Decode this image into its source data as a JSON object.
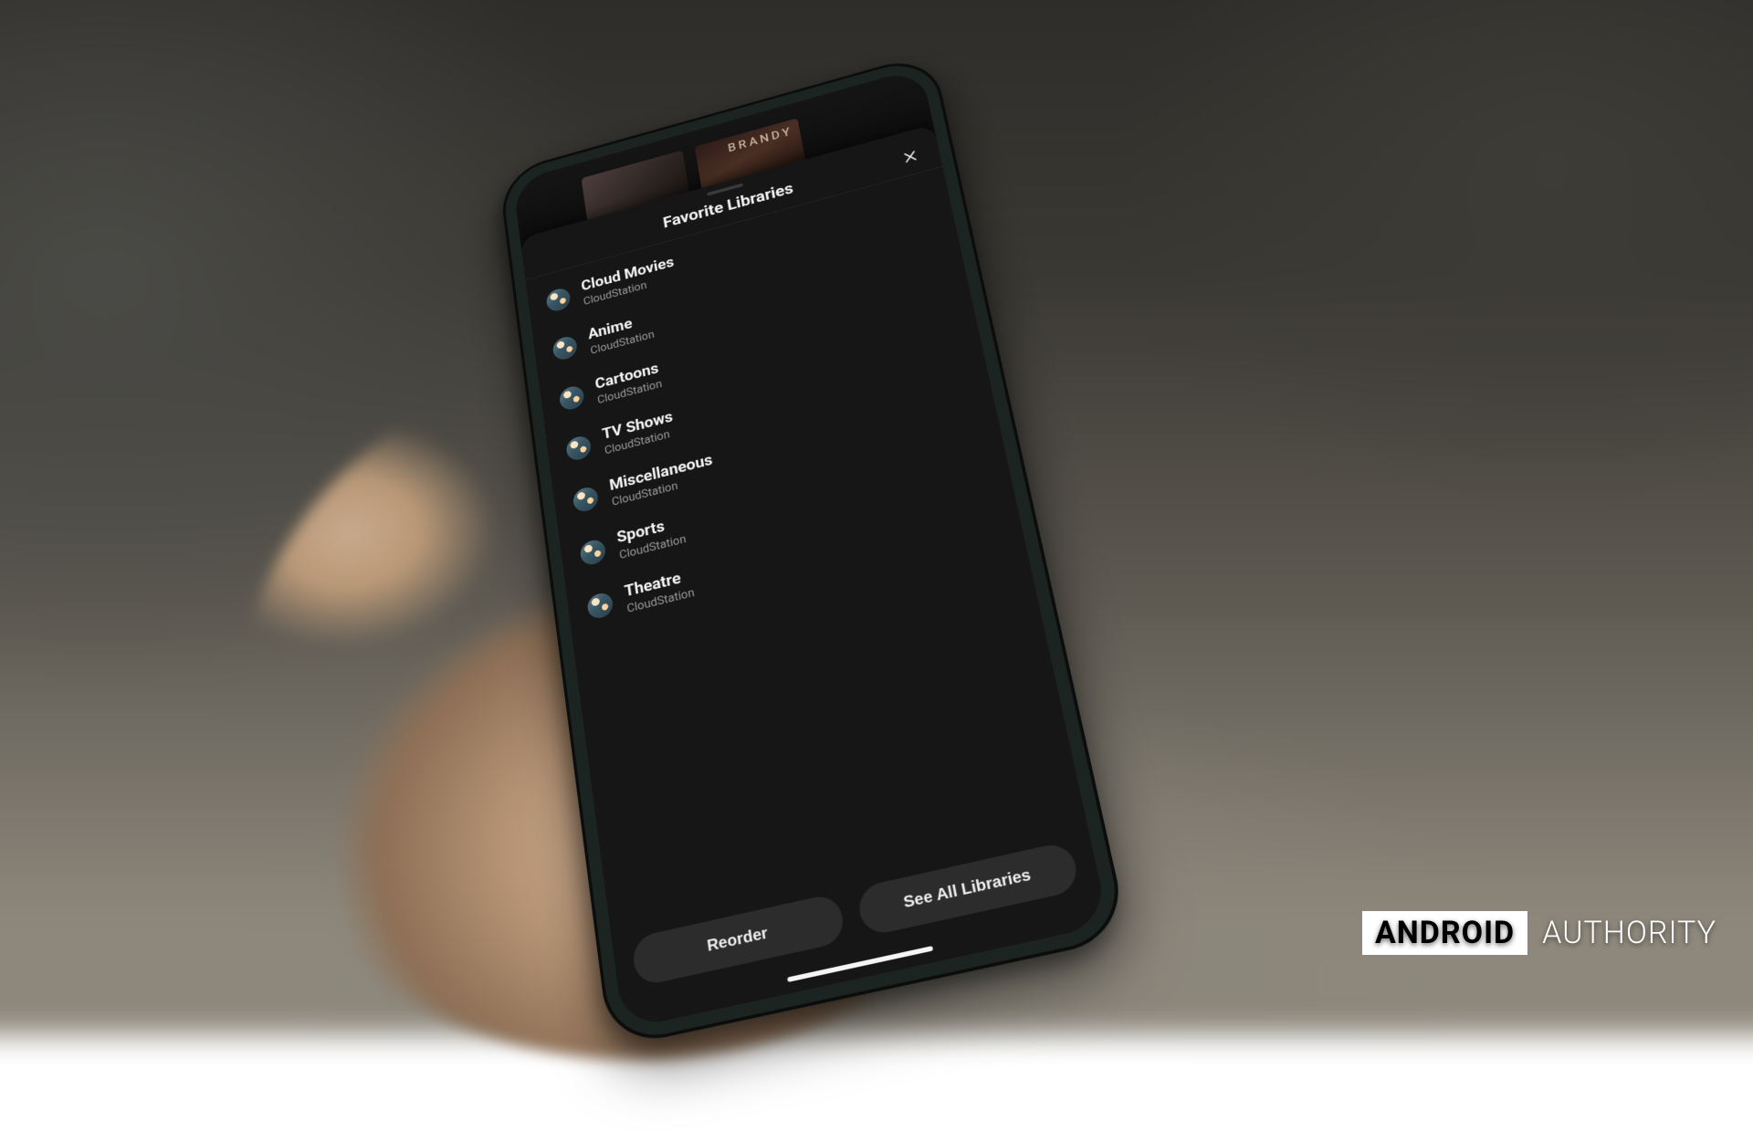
{
  "background_posters": [
    {
      "label": ""
    },
    {
      "label": "BRANDY"
    }
  ],
  "sheet": {
    "title": "Favorite Libraries",
    "close_icon": "close-icon",
    "items": [
      {
        "title": "Cloud Movies",
        "subtitle": "CloudStation"
      },
      {
        "title": "Anime",
        "subtitle": "CloudStation"
      },
      {
        "title": "Cartoons",
        "subtitle": "CloudStation"
      },
      {
        "title": "TV Shows",
        "subtitle": "CloudStation"
      },
      {
        "title": "Miscellaneous",
        "subtitle": "CloudStation"
      },
      {
        "title": "Sports",
        "subtitle": "CloudStation"
      },
      {
        "title": "Theatre",
        "subtitle": "CloudStation"
      }
    ],
    "actions": {
      "reorder": "Reorder",
      "see_all": "See All Libraries"
    }
  },
  "watermark": {
    "brand_boxed": "ANDROID",
    "brand_rest": "AUTHORITY"
  }
}
